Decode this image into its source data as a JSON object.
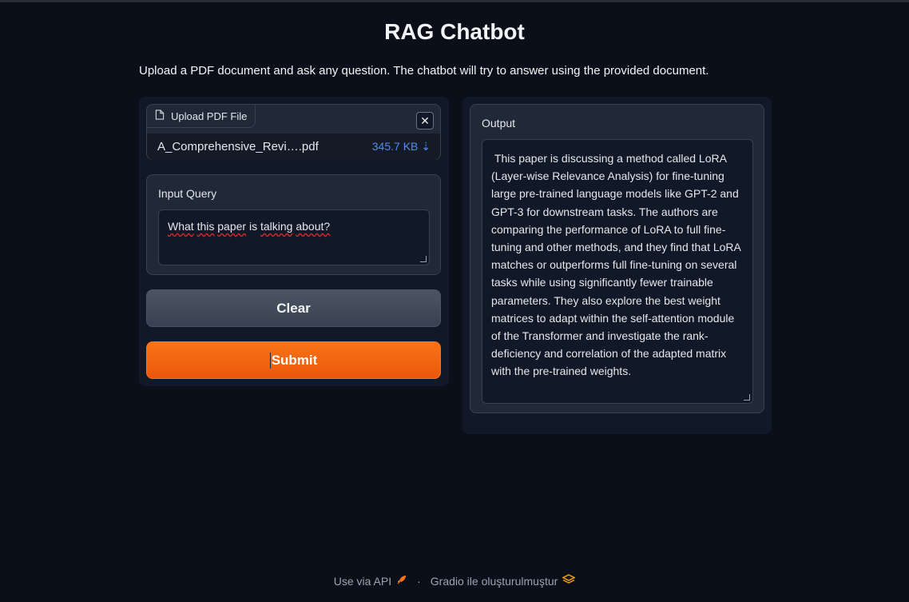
{
  "app": {
    "title": "RAG Chatbot",
    "description": "Upload a PDF document and ask any question. The chatbot will try to answer using the provided document."
  },
  "upload": {
    "label": "Upload PDF File",
    "close_symbol": "✕",
    "file_name": "A_Comprehensive_Revi….pdf",
    "file_size": "345.7 KB ⇣"
  },
  "query": {
    "label": "Input Query",
    "value_word1": "What",
    "value_word2": "this",
    "value_word3": "paper",
    "value_word4": "is",
    "value_word5": "talking",
    "value_word6": "about?"
  },
  "buttons": {
    "clear": "Clear",
    "submit": "Submit"
  },
  "output": {
    "label": "Output",
    "text": " This paper is discussing a method called LoRA (Layer-wise Relevance Analysis) for fine-tuning large pre-trained language models like GPT-2 and GPT-3 for downstream tasks. The authors are comparing the performance of LoRA to full fine-tuning and other methods, and they find that LoRA matches or outperforms full fine-tuning on several tasks while using significantly fewer trainable parameters. They also explore the best weight matrices to adapt within the self-attention module of the Transformer and investigate the rank-deficiency and correlation of the adapted matrix with the pre-trained weights."
  },
  "footer": {
    "api_link": "Use via API",
    "separator": "·",
    "built_with": "Gradio ile oluşturulmuştur"
  },
  "colors": {
    "background": "#0b0f19",
    "accent": "#f97316",
    "file_size_link": "#4f8cf7"
  }
}
